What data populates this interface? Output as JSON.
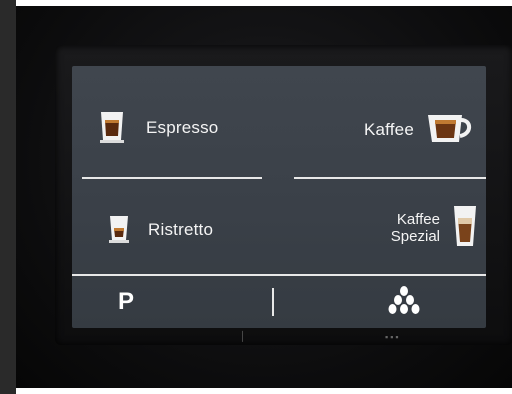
{
  "display": {
    "tiles": {
      "espresso": {
        "label": "Espresso",
        "icon": "espresso-cup-icon"
      },
      "kaffee": {
        "label": "Kaffee",
        "icon": "coffee-cup-icon"
      },
      "ristretto": {
        "label": "Ristretto",
        "icon": "ristretto-cup-icon"
      },
      "kaffee_spezial": {
        "line1": "Kaffee",
        "line2": "Spezial",
        "icon": "tall-glass-icon"
      }
    },
    "bottom_bar": {
      "p_label": "P",
      "strength_icon": "coffee-beans-icon"
    }
  },
  "colors": {
    "screen_bg": "#3c424a",
    "divider": "#e8e8e8",
    "coffee_crema": "#c07a32"
  }
}
